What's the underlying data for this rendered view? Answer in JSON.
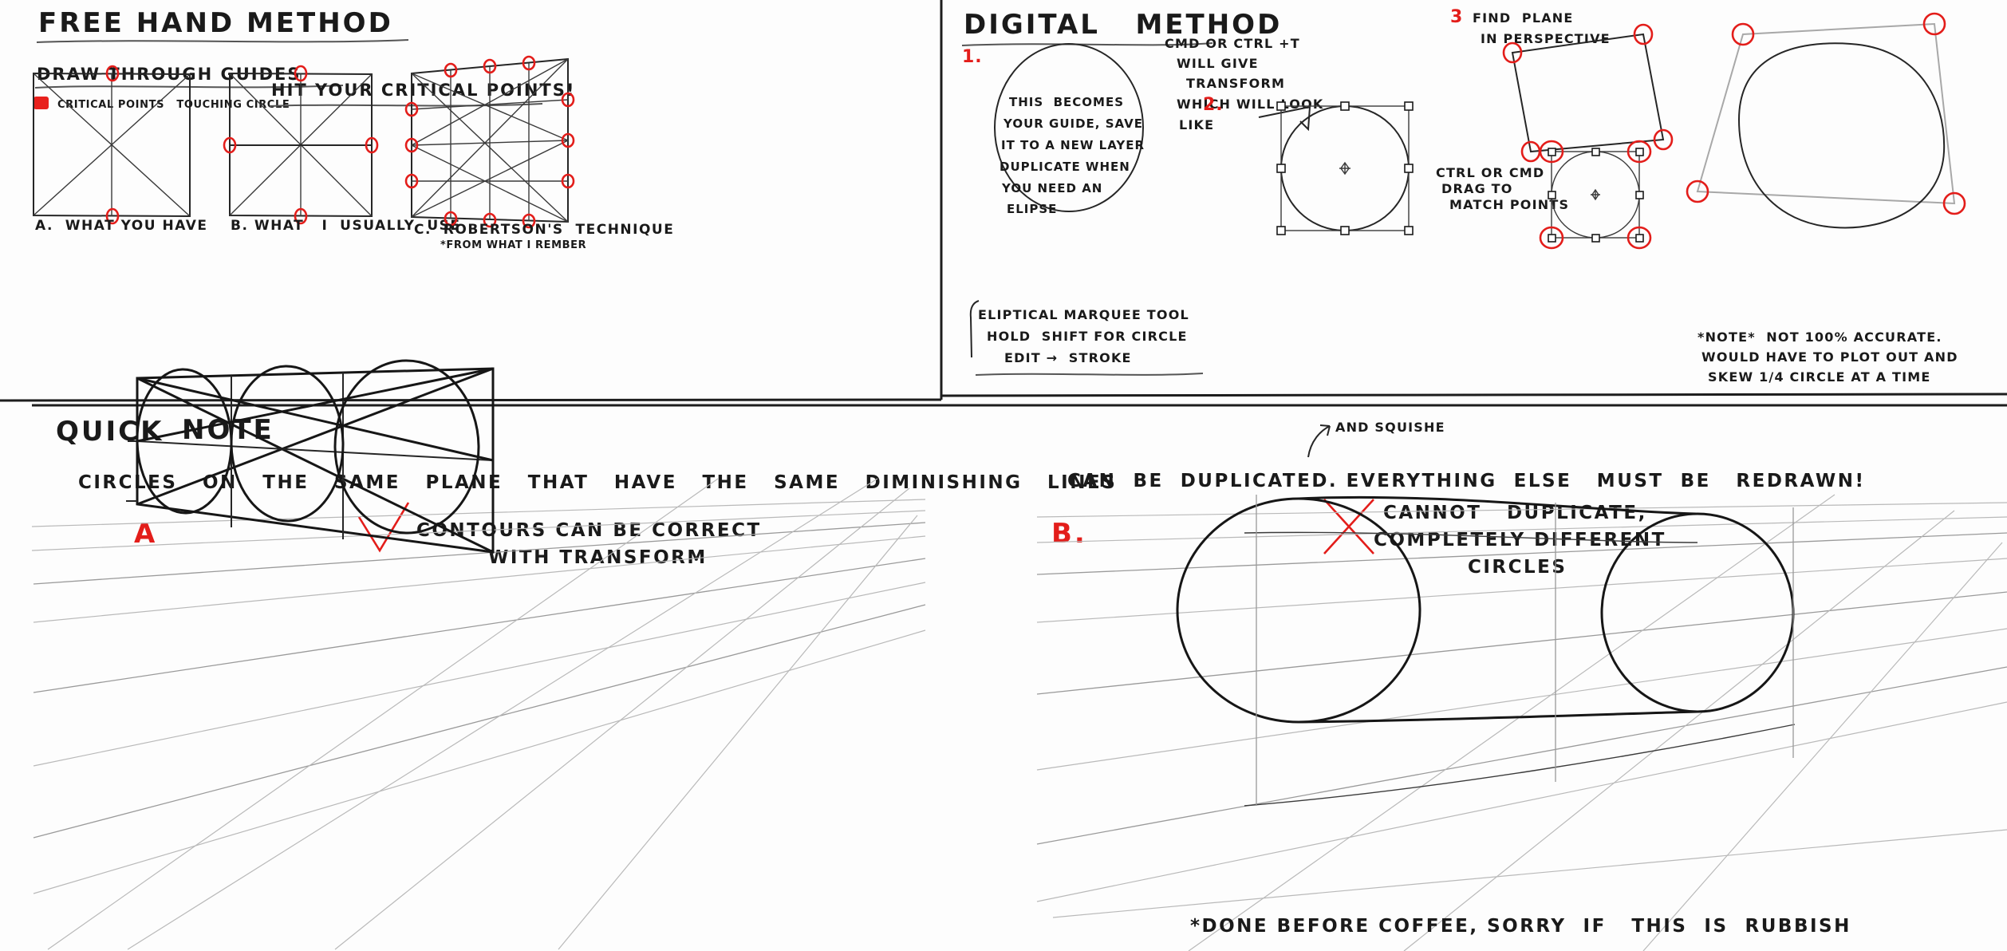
{
  "page": {
    "title": "Perspective Circle Drawing Notes",
    "background_color": "#fdfdfd",
    "ink_color": "#1a1a1a",
    "accent_color": "#e31d1a"
  },
  "panel_freehand": {
    "heading": "FREE HAND METHOD",
    "sub_heading_left": "DRAW THROUGH GUIDES",
    "legend_text": "CRITICAL POINTS   TOUCHING CIRCLE",
    "legend_swatch_color": "#e8201c",
    "sub_heading_right": "HIT YOUR CRITICAL POINTS!",
    "captions": [
      "A.  WHAT YOU HAVE",
      "B. WHAT   I  USUALLY  USE",
      "C.  ROBERTSON'S  TECHNIQUE",
      "*FROM WHAT I REMBER"
    ]
  },
  "panel_digital": {
    "heading": "DIGITAL   METHOD",
    "step1_label": "1.",
    "step2_label": "2.",
    "step3_label": "3",
    "circle_note_lines": [
      "THIS  BECOMES",
      "YOUR GUIDE, SAVE",
      "IT TO A NEW LAYER",
      "DUPLICATE WHEN",
      "YOU NEED AN",
      "ELIPSE"
    ],
    "marquee_note_lines": [
      "ELIPTICAL MARQUEE TOOL",
      "HOLD  SHIFT FOR CIRCLE",
      "EDIT →  STROKE"
    ],
    "transform_note_lines": [
      "CMD OR CTRL +T",
      "WILL GIVE",
      "TRANSFORM",
      "WHICH WILL LOOK",
      "LIKE"
    ],
    "find_plane_lines": [
      "FIND  PLANE",
      "IN PERSPECTIVE"
    ],
    "match_points_lines": [
      "CTRL OR CMD",
      "DRAG TO",
      "MATCH POINTS"
    ],
    "footnote_lines": [
      "*NOTE*  NOT 100% ACCURATE.",
      "WOULD HAVE TO PLOT OUT AND",
      "SKEW 1/4 CIRCLE AT A TIME"
    ]
  },
  "panel_quicknote": {
    "heading_word1": "QUICK",
    "heading_word2": "NOTE",
    "body_line_left": "CIRCLES   ON   THE   SAME   PLANE   THAT   HAVE   THE   SAME   DIMINISHING   LINES",
    "body_line_right": "CAN  BE  DUPLICATED. EVERYTHING  ELSE   MUST  BE   REDRAWN!",
    "squish_annotation": "AND SQUISHE",
    "example_a": {
      "label": "A",
      "mark": "check",
      "note_lines": [
        "CONTOURS CAN BE CORRECT",
        "WITH TRANSFORM"
      ]
    },
    "example_b": {
      "label": "B.",
      "mark": "cross",
      "note_lines": [
        "CANNOT   DUPLICATE,",
        "COMPLETELY DIFFERENT",
        "CIRCLES"
      ]
    },
    "footer": "*DONE BEFORE COFFEE, SORRY  IF   THIS  IS  RUBBISH"
  }
}
